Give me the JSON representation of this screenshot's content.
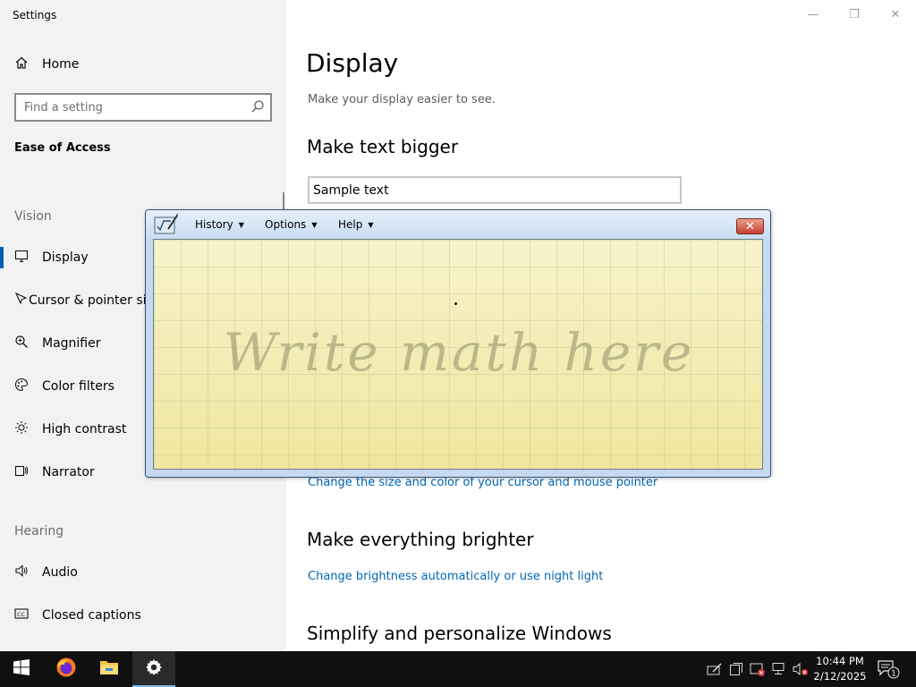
{
  "window": {
    "title": "Settings",
    "minimize_glyph": "—",
    "restore_glyph": "❐",
    "close_glyph": "✕"
  },
  "sidebar": {
    "home_label": "Home",
    "search_placeholder": "Find a setting",
    "category": "Ease of Access",
    "groups": {
      "vision": "Vision",
      "hearing": "Hearing"
    },
    "items": [
      {
        "label": "Display",
        "icon": "monitor-icon",
        "active": true
      },
      {
        "label": "Cursor & pointer size",
        "icon": "cursor-icon"
      },
      {
        "label": "Magnifier",
        "icon": "magnifier-icon"
      },
      {
        "label": "Color filters",
        "icon": "palette-icon"
      },
      {
        "label": "High contrast",
        "icon": "sun-icon"
      },
      {
        "label": "Narrator",
        "icon": "narrator-icon"
      },
      {
        "label": "Audio",
        "icon": "speaker-icon"
      },
      {
        "label": "Closed captions",
        "icon": "captions-icon"
      }
    ]
  },
  "main": {
    "title": "Display",
    "subtitle": "Make your display easier to see.",
    "sections": {
      "text_bigger": "Make text bigger",
      "brighter": "Make everything brighter",
      "simplify": "Simplify and personalize Windows"
    },
    "sample_text": "Sample text",
    "links": {
      "cursor": "Change the size and color of your cursor and mouse pointer",
      "brightness": "Change brightness automatically or use night light"
    }
  },
  "math_panel": {
    "menus": [
      "History",
      "Options",
      "Help"
    ],
    "hint": "Write math here",
    "close_glyph": "✕",
    "colors": {
      "paper": "#f5f0b8",
      "frame": "#c5daf0",
      "close": "#c8402c"
    }
  },
  "taskbar": {
    "apps": [
      "start-icon",
      "firefox-icon",
      "file-explorer-icon",
      "settings-icon"
    ],
    "clock_time": "10:44 PM",
    "clock_date": "2/12/2025",
    "notification_count": "1"
  },
  "colors": {
    "accent": "#0063b1",
    "link": "#0067b8",
    "taskbar": "#101010"
  }
}
